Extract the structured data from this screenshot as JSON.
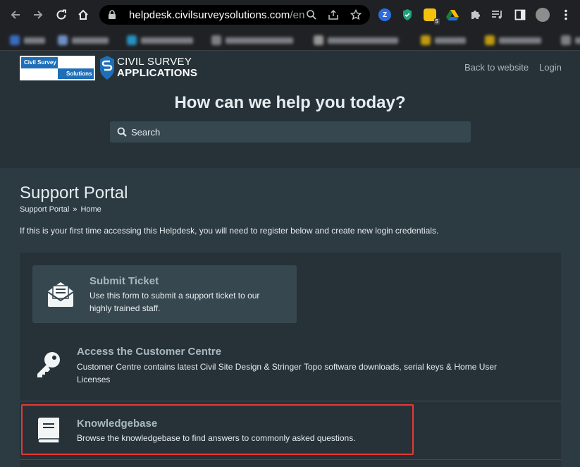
{
  "browser": {
    "url_main": "helpdesk.civilsurveysolutions.com",
    "url_rest": "/en",
    "ext_badge": "5"
  },
  "header": {
    "logo_text_1": "Civil Survey",
    "logo_text_2": "Solutions",
    "brand_line1": "CIVIL SURVEY",
    "brand_line2": "APPLICATIONS",
    "back_link": "Back to website",
    "login_link": "Login",
    "hero_title": "How can we help you today?",
    "search_placeholder": "Search"
  },
  "main": {
    "page_title": "Support Portal",
    "breadcrumb": [
      "Support Portal",
      "»",
      "Home"
    ],
    "intro": "If this is your first time accessing this Helpdesk, you will need to register below and create new login credentials.",
    "tiles": [
      {
        "title": "Submit Ticket",
        "desc_line1": "Use this form to submit a support ticket to our",
        "desc_line2": "highly trained staff.",
        "icon": "envelope-open-icon"
      },
      {
        "title": "Access the Customer Centre",
        "desc_line1": "Customer Centre contains latest Civil Site Design & Stringer Topo software downloads, serial keys & Home User",
        "desc_line2": "Licenses",
        "icon": "key-icon"
      },
      {
        "title": "Knowledgebase",
        "desc_line1": "Browse the knowledgebase to find answers to commonly asked questions.",
        "icon": "book-icon"
      }
    ]
  },
  "colors": {
    "page_bg": "#2c3a42",
    "header_bg": "#263238",
    "tile_bg": "#37474f",
    "tile_title": "#a8b8c0",
    "highlight": "#e53935",
    "logo_blue": "#1e6fb8"
  }
}
